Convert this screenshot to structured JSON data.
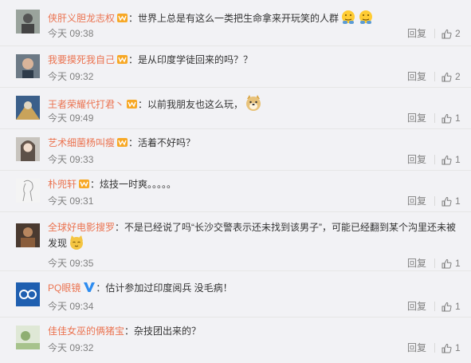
{
  "comments": [
    {
      "user": "侠肝义胆龙志权",
      "text": "：世界上总是有这么一类把生命拿来开玩笑的人群",
      "time": "今天 09:38",
      "reply": "回复",
      "likes": "2",
      "badge": "vip",
      "emoji": "face-hug-icon"
    },
    {
      "user": "我要摸死我自己",
      "text": "：是从印度学徒回来的吗？？",
      "time": "今天 09:32",
      "reply": "回复",
      "likes": "2",
      "badge": "vip"
    },
    {
      "user": "王者荣耀代打君丶",
      "text": "：以前我朋友也这么玩，",
      "time": "今天 09:49",
      "reply": "回复",
      "likes": "1",
      "badge": "vip",
      "emoji": "doge-icon"
    },
    {
      "user": "艺术细菌杨叫瘦",
      "text": "：活着不好吗？",
      "time": "今天 09:33",
      "reply": "回复",
      "likes": "1",
      "badge": "vip"
    },
    {
      "user": "朴兜轩",
      "text": "：炫技一时爽。。。。。",
      "time": "今天 09:31",
      "reply": "回复",
      "likes": "1",
      "badge": "vip"
    },
    {
      "user": "全球好电影搜罗",
      "text": "：不是已经说了吗“长沙交警表示还未找到该男子”，可能已经翻到某个沟里还未被发现",
      "time": "今天 09:35",
      "reply": "回复",
      "likes": "1",
      "badge": "none",
      "emoji": "cat-icon"
    },
    {
      "user": "PQ眼镜",
      "text": "：估计参加过印度阅兵 没毛病！",
      "time": "今天 09:34",
      "reply": "回复",
      "likes": "1",
      "badge": "verified-blue"
    },
    {
      "user": "佳佳女巫的俩猪宝",
      "text": "：杂技团出来的？",
      "time": "今天 09:32",
      "reply": "回复",
      "likes": "1",
      "badge": "none"
    }
  ]
}
